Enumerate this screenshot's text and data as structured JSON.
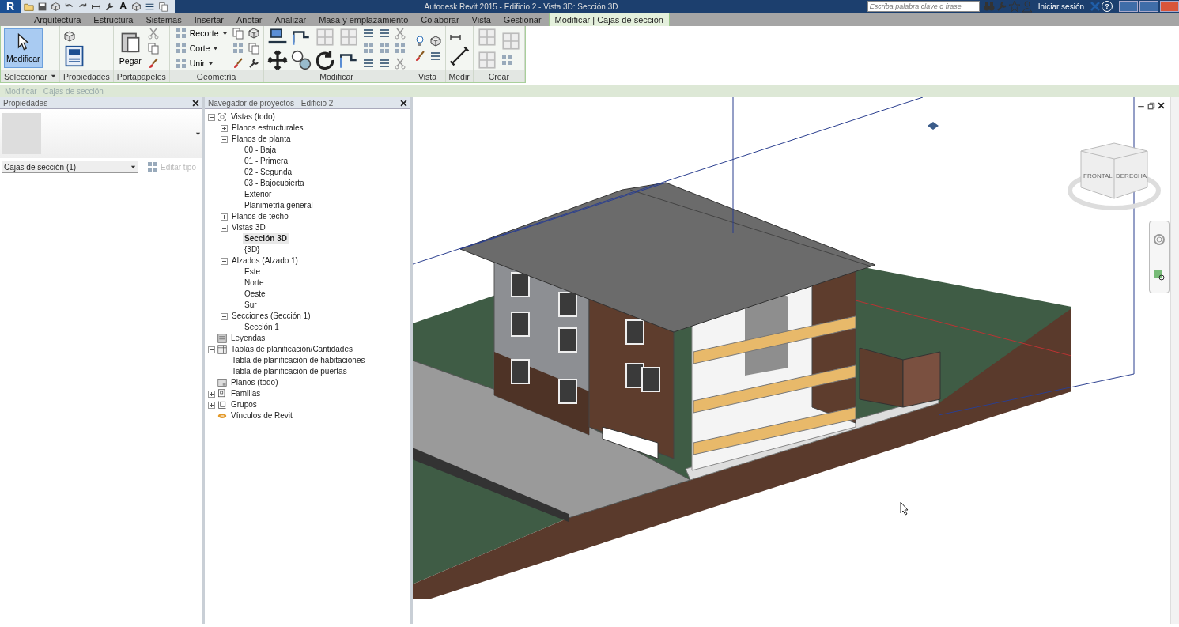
{
  "title_bar": {
    "app_letter": "R",
    "text_tool": "A",
    "title": "Autodesk Revit 2015 -   Edificio 2 - Vista 3D: Sección 3D",
    "search_placeholder": "Escriba palabra clave o frase",
    "sign_in": "Iniciar sesión",
    "help": "?"
  },
  "tabs": [
    {
      "label": "Arquitectura",
      "selected": false
    },
    {
      "label": "Estructura",
      "selected": false
    },
    {
      "label": "Sistemas",
      "selected": false
    },
    {
      "label": "Insertar",
      "selected": false
    },
    {
      "label": "Anotar",
      "selected": false
    },
    {
      "label": "Analizar",
      "selected": false
    },
    {
      "label": "Masa y emplazamiento",
      "selected": false
    },
    {
      "label": "Colaborar",
      "selected": false
    },
    {
      "label": "Vista",
      "selected": false
    },
    {
      "label": "Gestionar",
      "selected": false
    },
    {
      "label": "Modificar | Cajas de sección",
      "selected": true
    }
  ],
  "ribbon": [
    {
      "label": "Seleccionar",
      "dropdown": true,
      "tools": [
        {
          "label": "Modificar",
          "kind": "large",
          "selected": true
        }
      ]
    },
    {
      "label": "Propiedades",
      "dropdown": false
    },
    {
      "label": "Portapapeles",
      "dropdown": false,
      "tools": [
        {
          "label": "Pegar",
          "kind": "large",
          "selected": false
        }
      ]
    },
    {
      "label": "Geometría",
      "dropdown": false,
      "tools": [
        {
          "label": "Recorte",
          "kind": "small",
          "selected": false
        },
        {
          "label": "Corte",
          "kind": "small",
          "selected": false
        },
        {
          "label": "Unir",
          "kind": "small",
          "selected": false
        }
      ]
    },
    {
      "label": "Modificar",
      "dropdown": false
    },
    {
      "label": "Vista",
      "dropdown": false
    },
    {
      "label": "Medir",
      "dropdown": false
    },
    {
      "label": "Crear",
      "dropdown": false
    }
  ],
  "context_bar": "Modificar | Cajas de sección",
  "properties": {
    "title": "Propiedades",
    "type_selector": "Cajas de sección (1)",
    "edit_type": {
      "label": "Editar tipo",
      "disabled": true
    }
  },
  "browser": {
    "title": "Navegador de proyectos - Edificio 2",
    "tree": [
      {
        "label": "Vistas (todo)",
        "kind": "views",
        "expanded": true,
        "children": [
          {
            "label": "Planos estructurales",
            "expanded": false
          },
          {
            "label": "Planos de planta",
            "expanded": true,
            "children": [
              {
                "label": "00 - Baja",
                "selected": false
              },
              {
                "label": "01 - Primera",
                "selected": false
              },
              {
                "label": "02 - Segunda",
                "selected": false
              },
              {
                "label": "03 - Bajocubierta",
                "selected": false
              },
              {
                "label": "Exterior",
                "selected": false
              },
              {
                "label": "Planimetría general",
                "selected": false
              }
            ]
          },
          {
            "label": "Planos de techo",
            "expanded": false
          },
          {
            "label": "Vistas 3D",
            "expanded": true,
            "children": [
              {
                "label": "Sección 3D",
                "selected": true
              },
              {
                "label": "{3D}",
                "selected": false
              }
            ]
          },
          {
            "label": "Alzados (Alzado 1)",
            "expanded": true,
            "children": [
              {
                "label": "Este",
                "selected": false
              },
              {
                "label": "Norte",
                "selected": false
              },
              {
                "label": "Oeste",
                "selected": false
              },
              {
                "label": "Sur",
                "selected": false
              }
            ]
          },
          {
            "label": "Secciones (Sección 1)",
            "expanded": true,
            "children": [
              {
                "label": "Sección 1",
                "selected": false
              }
            ]
          }
        ]
      },
      {
        "label": "Leyendas",
        "kind": "legend"
      },
      {
        "label": "Tablas de planificación/Cantidades",
        "kind": "schedule",
        "expanded": true,
        "children": [
          {
            "label": "Tabla de planificación de habitaciones",
            "selected": false
          },
          {
            "label": "Tabla de planificación de puertas",
            "selected": false
          }
        ]
      },
      {
        "label": "Planos (todo)",
        "kind": "sheets"
      },
      {
        "label": "Familias",
        "kind": "families",
        "expanded": false
      },
      {
        "label": "Grupos",
        "kind": "groups",
        "expanded": false
      },
      {
        "label": "Vínculos de Revit",
        "kind": "links"
      }
    ]
  },
  "viewport": {
    "view_cube": {
      "front": "FRONTAL",
      "right": "DERECHA"
    }
  }
}
